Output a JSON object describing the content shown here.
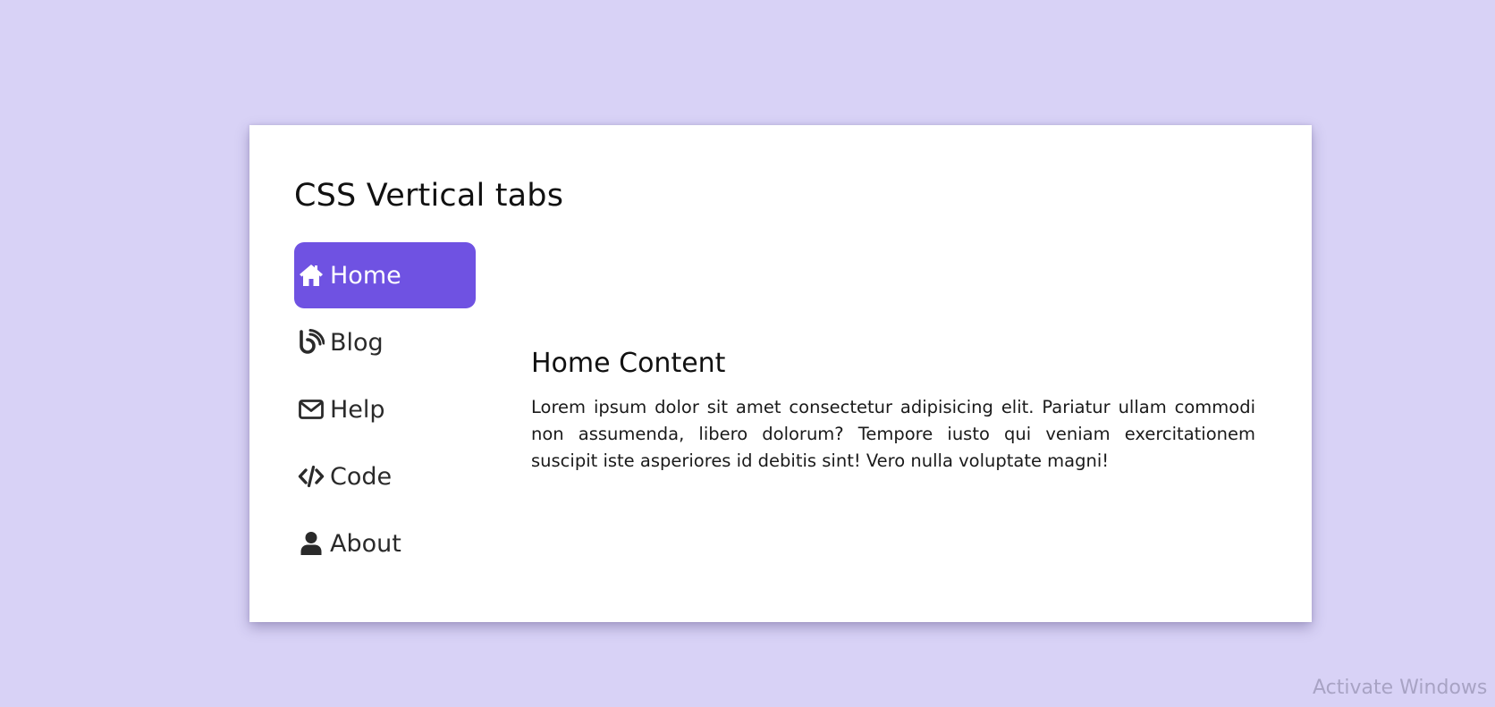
{
  "page": {
    "title": "CSS Vertical tabs",
    "background_color": "#d8d2f6",
    "card_color": "#ffffff",
    "accent_color": "#6f52e2"
  },
  "tabs": [
    {
      "label": "Home",
      "icon": "home-icon",
      "active": true
    },
    {
      "label": "Blog",
      "icon": "blog-icon",
      "active": false
    },
    {
      "label": "Help",
      "icon": "envelope-icon",
      "active": false
    },
    {
      "label": "Code",
      "icon": "code-icon",
      "active": false
    },
    {
      "label": "About",
      "icon": "user-icon",
      "active": false
    }
  ],
  "content": {
    "title": "Home Content",
    "text": "Lorem ipsum dolor sit amet consectetur adipisicing elit. Pariatur ullam commodi non assumenda, libero dolorum? Tempore iusto qui veniam exercitationem suscipit iste asperiores id debitis sint! Vero nulla voluptate magni!"
  },
  "watermark": {
    "text": "Activate Windows"
  }
}
